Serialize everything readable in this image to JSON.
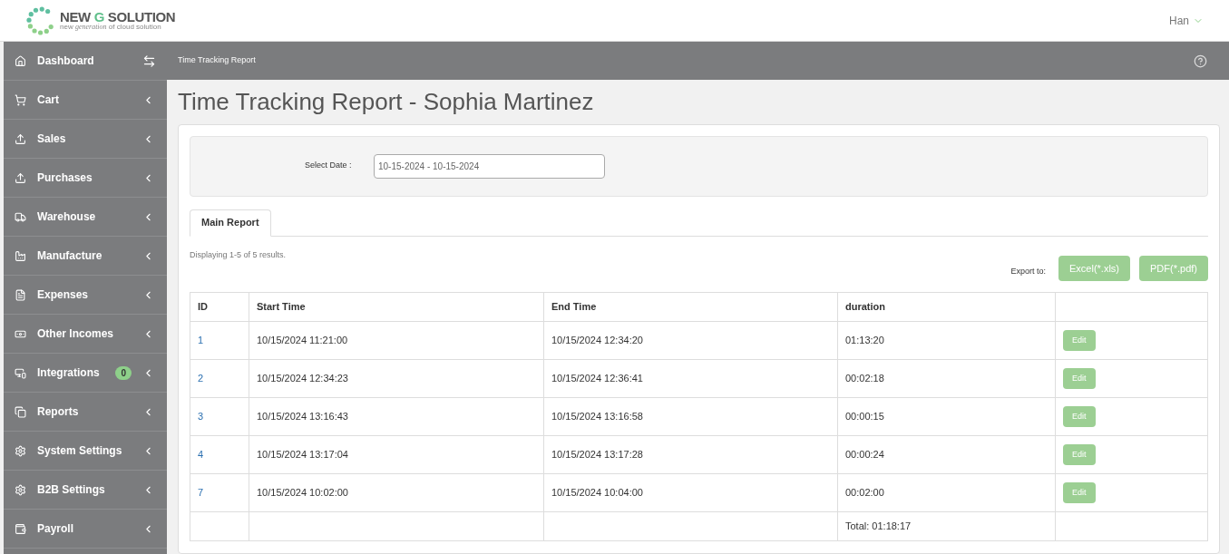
{
  "header": {
    "brand_pre": "NEW",
    "brand_accent": "G",
    "brand_post": "SOLUTION",
    "tagline_pre": "new",
    "tagline_mid": "generation",
    "tagline_post": "of cloud solution",
    "user": "Han"
  },
  "sidebar": {
    "items": [
      {
        "label": "Dashboard"
      },
      {
        "label": "Cart"
      },
      {
        "label": "Sales"
      },
      {
        "label": "Purchases"
      },
      {
        "label": "Warehouse"
      },
      {
        "label": "Manufacture"
      },
      {
        "label": "Expenses"
      },
      {
        "label": "Other Incomes"
      },
      {
        "label": "Integrations",
        "badge": "0"
      },
      {
        "label": "Reports"
      },
      {
        "label": "System Settings"
      },
      {
        "label": "B2B Settings"
      },
      {
        "label": "Payroll"
      }
    ]
  },
  "breadcrumb": "Time Tracking Report",
  "page_title": "Time Tracking Report - Sophia Martinez",
  "filter": {
    "label": "Select Date :",
    "value": "10-15-2024 - 10-15-2024"
  },
  "tabs": [
    {
      "label": "Main Report",
      "selected": true
    }
  ],
  "summary": "Displaying 1-5 of 5 results.",
  "export": {
    "label": "Export to:",
    "buttons": [
      "Excel(*.xls)",
      "PDF(*.pdf)"
    ]
  },
  "table": {
    "columns": [
      "ID",
      "Start Time",
      "End Time",
      "duration",
      ""
    ],
    "rows": [
      {
        "id": "1",
        "start": "10/15/2024 11:21:00",
        "end": "10/15/2024 12:34:20",
        "duration": "01:13:20",
        "action": "Edit"
      },
      {
        "id": "2",
        "start": "10/15/2024 12:34:23",
        "end": "10/15/2024 12:36:41",
        "duration": "00:02:18",
        "action": "Edit"
      },
      {
        "id": "3",
        "start": "10/15/2024 13:16:43",
        "end": "10/15/2024 13:16:58",
        "duration": "00:00:15",
        "action": "Edit"
      },
      {
        "id": "4",
        "start": "10/15/2024 13:17:04",
        "end": "10/15/2024 13:17:28",
        "duration": "00:00:24",
        "action": "Edit"
      },
      {
        "id": "7",
        "start": "10/15/2024 10:02:00",
        "end": "10/15/2024 10:04:00",
        "duration": "00:02:00",
        "action": "Edit"
      }
    ],
    "total": "Total: 01:18:17"
  }
}
